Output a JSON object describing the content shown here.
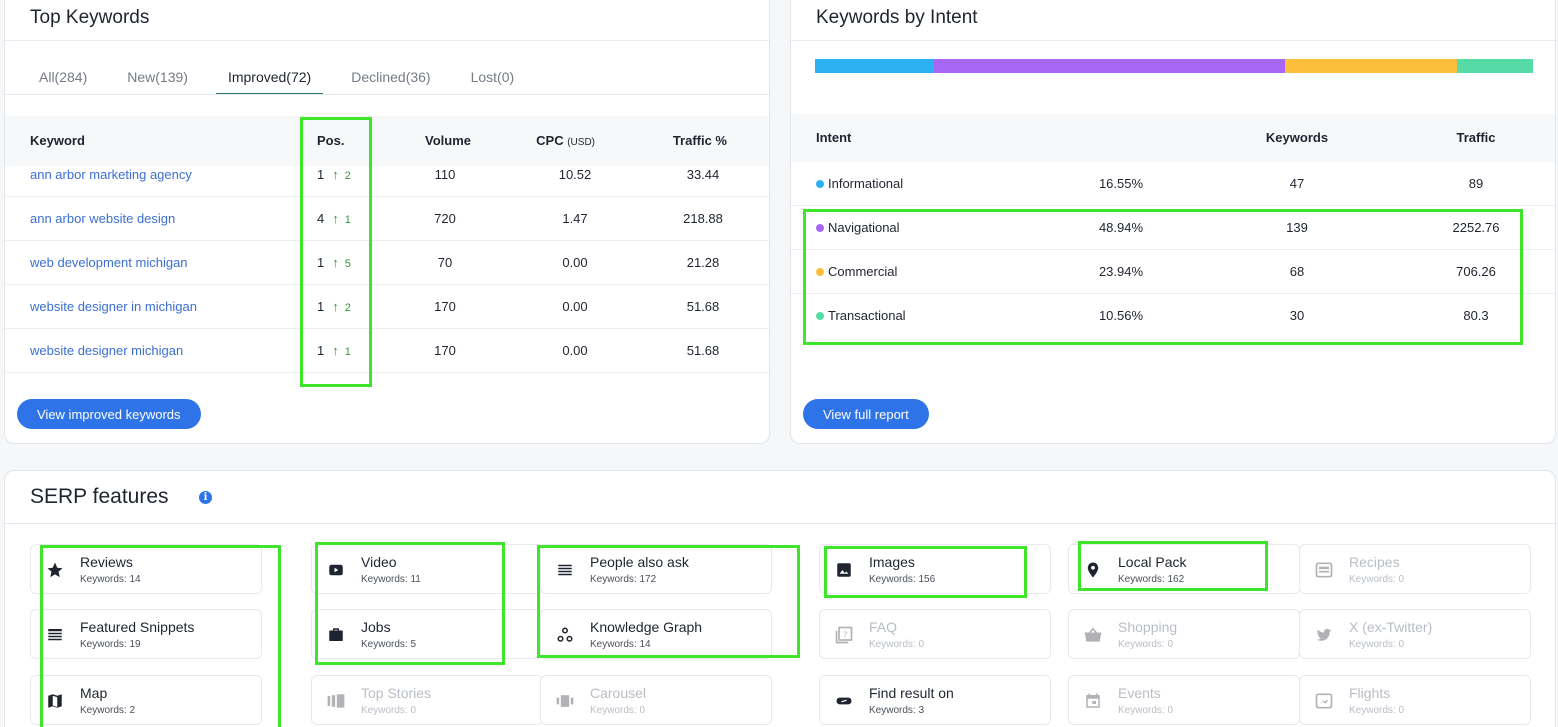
{
  "top_keywords": {
    "title": "Top Keywords",
    "tabs": [
      {
        "label": "All(284)",
        "active": false
      },
      {
        "label": "New(139)",
        "active": false
      },
      {
        "label": "Improved(72)",
        "active": true
      },
      {
        "label": "Declined(36)",
        "active": false
      },
      {
        "label": "Lost(0)",
        "active": false
      }
    ],
    "columns": {
      "keyword": "Keyword",
      "pos": "Pos.",
      "volume": "Volume",
      "cpc": "CPC",
      "cpc_unit": "(USD)",
      "traffic": "Traffic %"
    },
    "rows": [
      {
        "keyword": "ann arbor marketing agency",
        "pos": "1",
        "change": "2",
        "volume": "110",
        "cpc": "10.52",
        "traffic": "33.44"
      },
      {
        "keyword": "ann arbor website design",
        "pos": "4",
        "change": "1",
        "volume": "720",
        "cpc": "1.47",
        "traffic": "218.88"
      },
      {
        "keyword": "web development michigan",
        "pos": "1",
        "change": "5",
        "volume": "70",
        "cpc": "0.00",
        "traffic": "21.28"
      },
      {
        "keyword": "website designer in michigan",
        "pos": "1",
        "change": "2",
        "volume": "170",
        "cpc": "0.00",
        "traffic": "51.68"
      },
      {
        "keyword": "website designer michigan",
        "pos": "1",
        "change": "1",
        "volume": "170",
        "cpc": "0.00",
        "traffic": "51.68"
      }
    ],
    "button": "View improved keywords"
  },
  "intent": {
    "title": "Keywords by Intent",
    "bar": [
      {
        "share": 16.55,
        "color": "#2db1f5"
      },
      {
        "share": 48.94,
        "color": "#a866f5"
      },
      {
        "share": 23.94,
        "color": "#fbbf3c"
      },
      {
        "share": 10.56,
        "color": "#57dba6"
      }
    ],
    "columns": {
      "intent": "Intent",
      "keywords": "Keywords",
      "traffic": "Traffic"
    },
    "rows": [
      {
        "name": "Informational",
        "pct": "16.55%",
        "keywords": "47",
        "traffic": "89",
        "color": "#2db1f5"
      },
      {
        "name": "Navigational",
        "pct": "48.94%",
        "keywords": "139",
        "traffic": "2252.76",
        "color": "#a866f5"
      },
      {
        "name": "Commercial",
        "pct": "23.94%",
        "keywords": "68",
        "traffic": "706.26",
        "color": "#fbbf3c"
      },
      {
        "name": "Transactional",
        "pct": "10.56%",
        "keywords": "30",
        "traffic": "80.3",
        "color": "#57dba6"
      }
    ],
    "button": "View full report"
  },
  "serp": {
    "title": "SERP features",
    "info_glyph": "i",
    "features": [
      {
        "name": "Reviews",
        "count": "Keywords: 14",
        "icon": "star-icon",
        "disabled": false
      },
      {
        "name": "Video",
        "count": "Keywords: 11",
        "icon": "video-icon",
        "disabled": false
      },
      {
        "name": "People also ask",
        "count": "Keywords: 172",
        "icon": "list-icon",
        "disabled": false
      },
      {
        "name": "Images",
        "count": "Keywords: 156",
        "icon": "image-icon",
        "disabled": false
      },
      {
        "name": "Local Pack",
        "count": "Keywords: 162",
        "icon": "pin-icon",
        "disabled": false
      },
      {
        "name": "Recipes",
        "count": "Keywords: 0",
        "icon": "recipe-icon",
        "disabled": true
      },
      {
        "name": "Featured Snippets",
        "count": "Keywords: 19",
        "icon": "snippet-icon",
        "disabled": false
      },
      {
        "name": "Jobs",
        "count": "Keywords: 5",
        "icon": "briefcase-icon",
        "disabled": false
      },
      {
        "name": "Knowledge Graph",
        "count": "Keywords: 14",
        "icon": "graph-icon",
        "disabled": false
      },
      {
        "name": "FAQ",
        "count": "Keywords: 0",
        "icon": "faq-icon",
        "disabled": true
      },
      {
        "name": "Shopping",
        "count": "Keywords: 0",
        "icon": "basket-icon",
        "disabled": true
      },
      {
        "name": "X (ex-Twitter)",
        "count": "Keywords: 0",
        "icon": "bird-icon",
        "disabled": true
      },
      {
        "name": "Map",
        "count": "Keywords: 2",
        "icon": "map-icon",
        "disabled": false
      },
      {
        "name": "Top Stories",
        "count": "Keywords: 0",
        "icon": "stories-icon",
        "disabled": true
      },
      {
        "name": "Carousel",
        "count": "Keywords: 0",
        "icon": "carousel-icon",
        "disabled": true
      },
      {
        "name": "Find result on",
        "count": "Keywords: 3",
        "icon": "link-icon",
        "disabled": false
      },
      {
        "name": "Events",
        "count": "Keywords: 0",
        "icon": "calendar-icon",
        "disabled": true
      },
      {
        "name": "Flights",
        "count": "Keywords: 0",
        "icon": "flight-icon",
        "disabled": true
      }
    ]
  },
  "colors": {
    "highlight": "#3ee52a",
    "link": "#3b6fd1",
    "primary_button": "#2e73e8",
    "positive": "#2e9a3c"
  }
}
